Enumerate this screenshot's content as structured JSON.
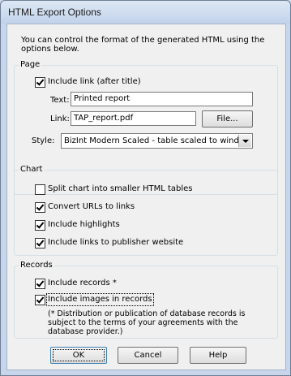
{
  "window": {
    "title": "HTML Export Options"
  },
  "intro": "You can control the format of the generated HTML using the options below.",
  "page_group": {
    "legend": "Page",
    "include_link": {
      "label": "Include link (after title)",
      "checked": true
    },
    "text_label": "Text:",
    "text_value": "Printed report",
    "link_label": "Link:",
    "link_value": "TAP_report.pdf",
    "file_button": "File...",
    "style_label": "Style:",
    "style_value": "BizInt Modern Scaled - table scaled to window"
  },
  "chart_group": {
    "legend": "Chart",
    "items": [
      {
        "label": "Split chart into smaller HTML tables",
        "checked": false
      },
      {
        "label": "Convert URLs to links",
        "checked": true
      },
      {
        "label": "Include highlights",
        "checked": true
      },
      {
        "label": "Include links to publisher website",
        "checked": true
      }
    ]
  },
  "records_group": {
    "legend": "Records",
    "items": [
      {
        "label": "Include records *",
        "checked": true
      },
      {
        "label": "Include images in records",
        "checked": true
      }
    ],
    "note": "(* Distribution or publication of database records is subject to the terms of your agreements with the database provider.)"
  },
  "buttons": {
    "ok": "OK",
    "cancel": "Cancel",
    "help": "Help"
  }
}
